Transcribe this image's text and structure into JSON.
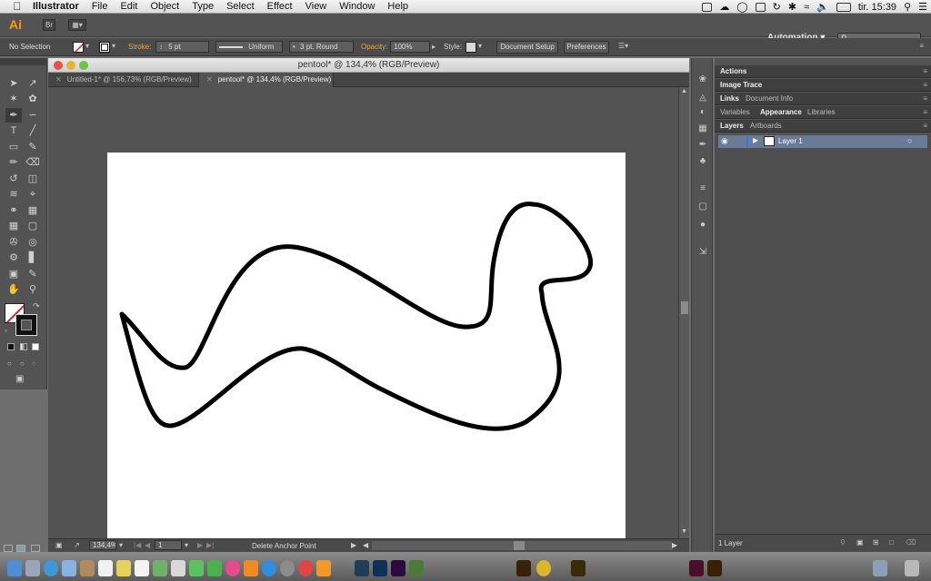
{
  "menubar": {
    "app_name": "Illustrator",
    "items": [
      "File",
      "Edit",
      "Object",
      "Type",
      "Select",
      "Effect",
      "View",
      "Window",
      "Help"
    ],
    "clock": "tir. 15:39"
  },
  "appbar": {
    "logo": "Ai",
    "bridge_label": "Br",
    "workspace": "Automation"
  },
  "control_bar": {
    "selection_status": "No Selection",
    "stroke_label": "Stroke:",
    "stroke_value": "5 pt",
    "profile_value": "Uniform",
    "brush_value": "3 pt. Round",
    "opacity_label": "Opacity:",
    "opacity_value": "100%",
    "style_label": "Style:",
    "document_setup": "Document Setup",
    "preferences": "Preferences"
  },
  "document": {
    "window_title": "pentool* @ 134,4% (RGB/Preview)",
    "tabs": [
      {
        "label": "Untitled-1* @ 156,73% (RGB/Preview)"
      },
      {
        "label": "pentool* @ 134,4% (RGB/Preview)"
      }
    ],
    "zoom": "134,4%",
    "artboard_number": "1",
    "status_text": "Delete Anchor Point"
  },
  "panels": {
    "actions": "Actions",
    "image_trace": "Image Trace",
    "links": "Links",
    "document_info": "Document Info",
    "variables": "Variables",
    "appearance": "Appearance",
    "libraries": "Libraries",
    "layers": "Layers",
    "artboards": "Artboards",
    "layer_name": "Layer 1",
    "layer_count": "1 Layer"
  },
  "colors": {
    "accent_orange": "#f0a43a",
    "layer_highlight": "#6a7b97",
    "ui_dark": "#535353"
  }
}
